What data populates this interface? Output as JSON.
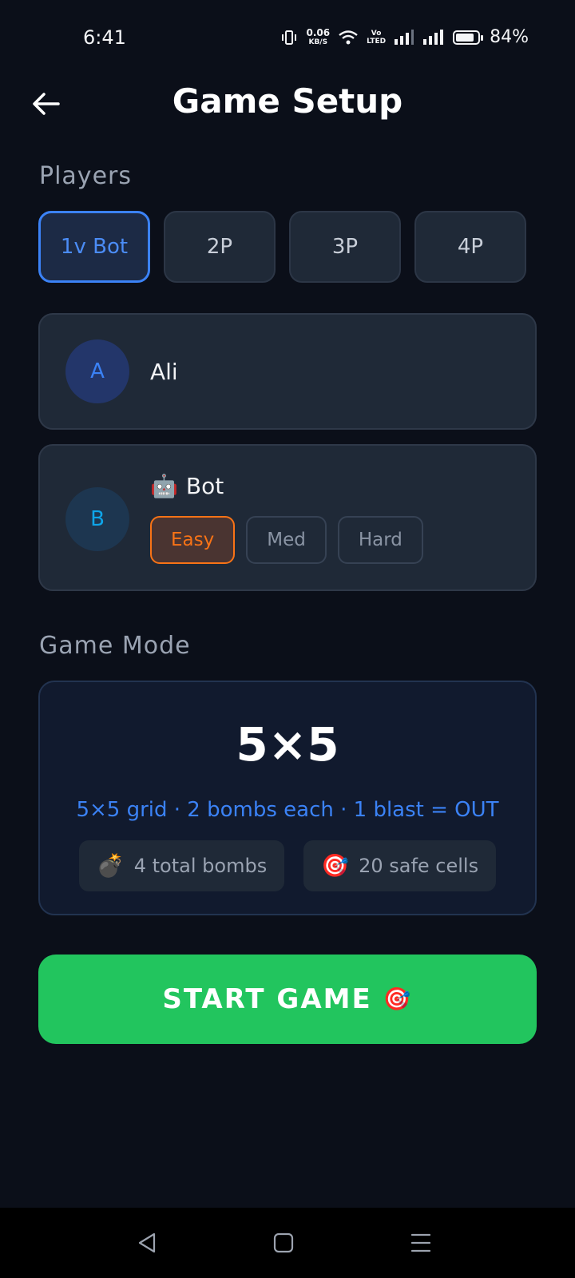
{
  "status_bar": {
    "time": "6:41",
    "net_speed": "0.06",
    "net_unit": "KB/S",
    "volte_top": "Vo",
    "volte_bottom": "LTED",
    "battery_pct": "84%",
    "battery_level": 0.84
  },
  "header": {
    "title": "Game Setup",
    "back_icon": "arrow-left-icon"
  },
  "players_section": {
    "label": "Players",
    "tabs": [
      {
        "label": "1v Bot",
        "active": true
      },
      {
        "label": "2P",
        "active": false
      },
      {
        "label": "3P",
        "active": false
      },
      {
        "label": "4P",
        "active": false
      }
    ]
  },
  "player_cards": [
    {
      "avatar": "A",
      "name": "Ali"
    },
    {
      "avatar": "B",
      "emoji": "🤖",
      "name": "Bot",
      "difficulties": [
        {
          "label": "Easy",
          "active": true
        },
        {
          "label": "Med",
          "active": false
        },
        {
          "label": "Hard",
          "active": false
        }
      ]
    }
  ],
  "game_mode": {
    "label": "Game Mode",
    "title": "5×5",
    "description": "5×5 grid · 2 bombs each · 1 blast = OUT",
    "chips": [
      {
        "emoji": "💣",
        "text": "4 total bombs"
      },
      {
        "emoji": "🎯",
        "text": "20 safe cells"
      }
    ]
  },
  "start_button": {
    "label": "START GAME",
    "emoji": "🎯"
  },
  "colors": {
    "background": "#0b0f19",
    "accent_blue": "#3b82f6",
    "accent_orange": "#f97316",
    "start_green": "#22c55e"
  }
}
